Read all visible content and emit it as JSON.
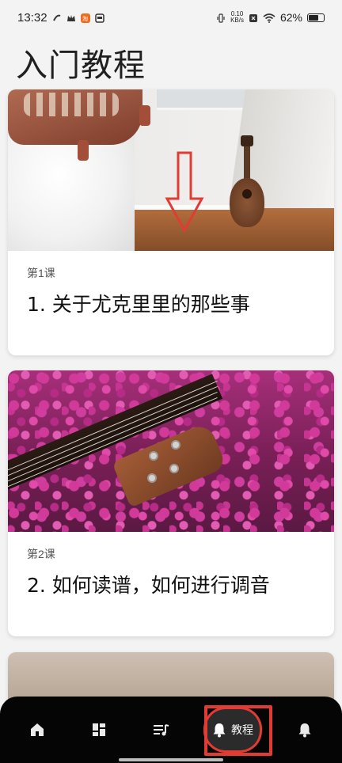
{
  "status_bar": {
    "time": "13:32",
    "network_speed": "0.10\nKB/s",
    "battery": "62%"
  },
  "page": {
    "title": "入门教程"
  },
  "lessons": [
    {
      "number": "第1课",
      "title": "1. 关于尤克里里的那些事"
    },
    {
      "number": "第2课",
      "title": "2. 如何读谱，如何进行调音"
    }
  ],
  "bottom_nav": {
    "items": [
      {
        "name": "home",
        "icon": "home-icon"
      },
      {
        "name": "dashboard",
        "icon": "dashboard-icon"
      },
      {
        "name": "playlist",
        "icon": "music-list-icon"
      },
      {
        "name": "tutorial",
        "icon": "bell-icon",
        "label": "教程",
        "active": true
      },
      {
        "name": "notifications",
        "icon": "bell-icon"
      }
    ]
  },
  "colors": {
    "background": "#f3f3f3",
    "nav_bg": "#050505",
    "highlight_red": "#e13c33",
    "active_pill": "#2b2b2b"
  }
}
